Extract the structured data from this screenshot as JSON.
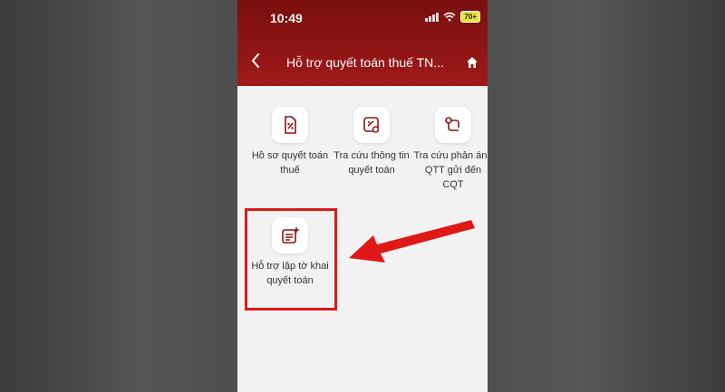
{
  "status_bar": {
    "time": "10:49",
    "battery": "70+"
  },
  "nav": {
    "title": "Hỗ trợ quyết toán thuế TN..."
  },
  "tiles": [
    {
      "label": "Hồ sơ quyết toán thuế",
      "icon": "tax-document-icon"
    },
    {
      "label": "Tra cứu thông tin quyết toán",
      "icon": "search-document-icon"
    },
    {
      "label": "Tra cứu phản ánh QTT gửi đến CQT",
      "icon": "route-icon"
    },
    {
      "label": "Hỗ trợ lập tờ khai quyết toán",
      "icon": "form-sparkle-icon"
    }
  ],
  "colors": {
    "header": "#8e1515",
    "accent": "#e01818",
    "icon": "#8b1414"
  }
}
